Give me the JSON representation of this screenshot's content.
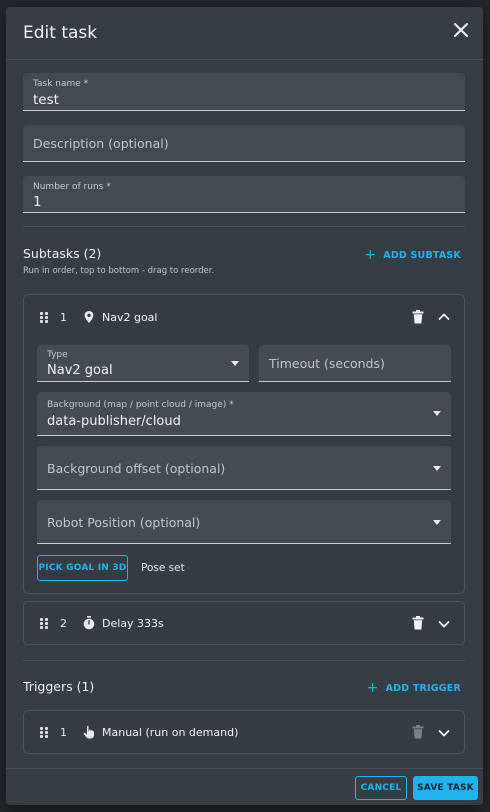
{
  "dialog": {
    "title": "Edit task",
    "close_icon": "close-icon"
  },
  "form": {
    "task_name": {
      "label": "Task name *",
      "value": "test"
    },
    "description": {
      "placeholder": "Description (optional)"
    },
    "number_of_runs": {
      "label": "Number of runs *",
      "value": "1"
    }
  },
  "subtasks": {
    "title": "Subtasks (2)",
    "hint": "Run in order, top to bottom - drag to reorder.",
    "add_label": "ADD SUBTASK",
    "items": [
      {
        "index": "1",
        "icon": "location-pin-icon",
        "name": "Nav2 goal",
        "expanded": true,
        "type_label": "Type",
        "type_value": "Nav2 goal",
        "timeout_placeholder": "Timeout (seconds)",
        "background_label": "Background (map / point cloud / image) *",
        "background_value": "data-publisher/cloud",
        "background_offset_placeholder": "Background offset (optional)",
        "robot_position_placeholder": "Robot Position (optional)",
        "pick_goal_label": "PICK GOAL IN 3D",
        "pose_status": "Pose set"
      },
      {
        "index": "2",
        "icon": "stopwatch-icon",
        "name": "Delay 333s",
        "expanded": false
      }
    ]
  },
  "triggers": {
    "title": "Triggers (1)",
    "add_label": "ADD TRIGGER",
    "items": [
      {
        "index": "1",
        "icon": "tap-hand-icon",
        "name": "Manual (run on demand)",
        "expanded": false
      }
    ]
  },
  "footer": {
    "cancel_label": "CANCEL",
    "save_label": "SAVE TASK"
  },
  "colors": {
    "accent": "#1fb4f0",
    "dialog_bg": "#373d44",
    "field_bg": "#444a52"
  }
}
